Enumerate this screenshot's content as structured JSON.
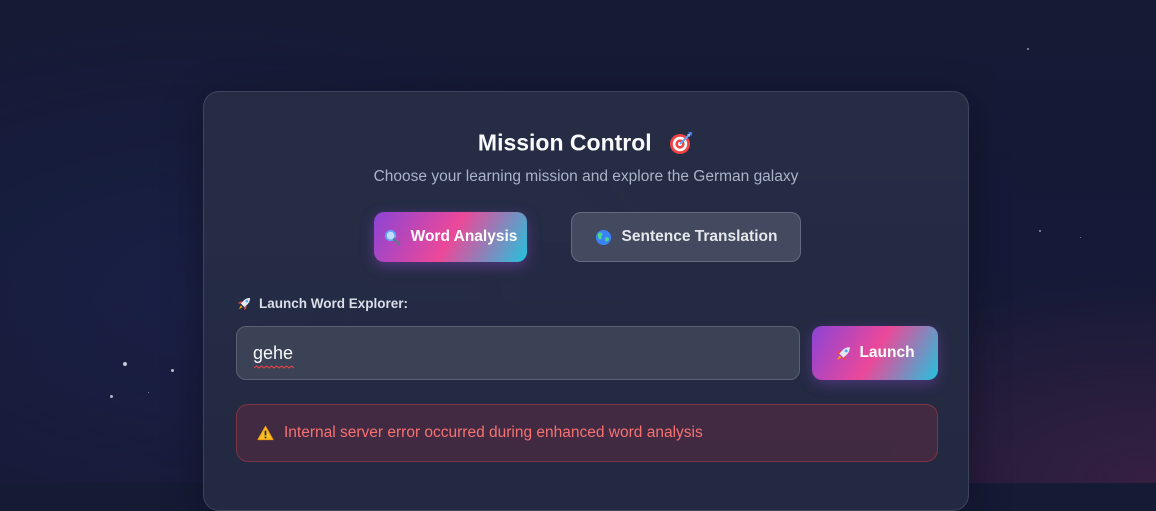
{
  "mission": {
    "title": "Mission Control",
    "title_icon": "target-icon",
    "subtitle": "Choose your learning mission and explore the German galaxy"
  },
  "modes": [
    {
      "label": "Word Analysis",
      "icon": "magnifier-icon",
      "active": true
    },
    {
      "label": "Sentence Translation",
      "icon": "globe-icon",
      "active": false
    }
  ],
  "word_explorer": {
    "label": "Launch Word Explorer:",
    "label_icon": "rocket-icon",
    "input_value": "gehe",
    "launch_label": "Launch",
    "launch_icon": "rocket-icon"
  },
  "error": {
    "icon": "warning-icon",
    "message": "Internal server error occurred during enhanced word analysis"
  },
  "colors": {
    "accent_gradient": [
      "#8b44d6",
      "#ec4899",
      "#22c3dd"
    ],
    "error_text": "#f87171",
    "background": "#151a35"
  }
}
